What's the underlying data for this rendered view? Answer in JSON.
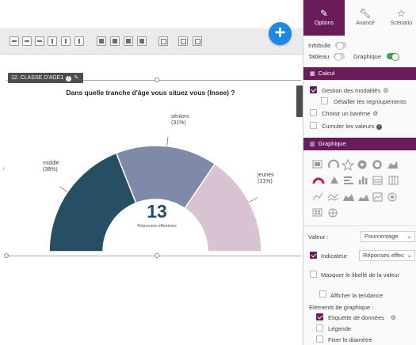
{
  "toolbar": {
    "buttons": [
      "align-left",
      "align-center",
      "align-right",
      "align-top",
      "align-middle",
      "align-bottom",
      "bring-forward",
      "send-backward",
      "bring-front",
      "send-back",
      "group",
      "distribute-h",
      "distribute-v"
    ]
  },
  "question": {
    "tag": "12. CLASSE D'AGE1",
    "title": "Dans quelle tranche d'âge vous situez vous (Insee) ?"
  },
  "chart_data": {
    "type": "pie",
    "subtype": "half-donut",
    "categories": [
      "middle",
      "séniors",
      "jeunes"
    ],
    "values": [
      38,
      31,
      31
    ],
    "unit": "%",
    "colors": [
      "#264f63",
      "#7e8aa8",
      "#d9c3d2"
    ],
    "center_value": "13",
    "center_label": "Réponses effectives",
    "labels": [
      {
        "name": "middle",
        "pct": "(38%)"
      },
      {
        "name": "séniors",
        "pct": "(31%)"
      },
      {
        "name": "jeunes",
        "pct": "(31%)"
      }
    ]
  },
  "panel": {
    "tabs": [
      {
        "label": "Options",
        "icon": "pencil-icon",
        "active": true
      },
      {
        "label": "Avancé",
        "icon": "wrench-icon",
        "active": false
      },
      {
        "label": "Scénario",
        "icon": "star-icon",
        "active": false
      }
    ],
    "infobulle": "Infobulle",
    "tableau": "Tableau",
    "graphique": "Graphique",
    "toggles": {
      "infobulle": false,
      "tableau": false,
      "graphique": true
    },
    "calcul": {
      "header": "Calcul",
      "gestion": "Gestion des modalités",
      "detailler": "Détailler les regroupements",
      "bareme": "Choisir un barème",
      "cumuler": "Cumuler les valeurs"
    },
    "graphique_section": {
      "header": "Graphique",
      "valeur_label": "Valeur :",
      "valeur_value": "Pourcentage",
      "indicateur_label": "Indicateur",
      "indicateur_value": "Réponses effec",
      "masquer": "Masquer le libellé de la valeur",
      "tendance": "Afficher la tendance",
      "elements_label": "Eléments de graphique :",
      "etiquette": "Etiquette de données",
      "legende": "Légende",
      "fixer": "Fixer le diamètre"
    },
    "accent_color": "#6a1b5a"
  }
}
